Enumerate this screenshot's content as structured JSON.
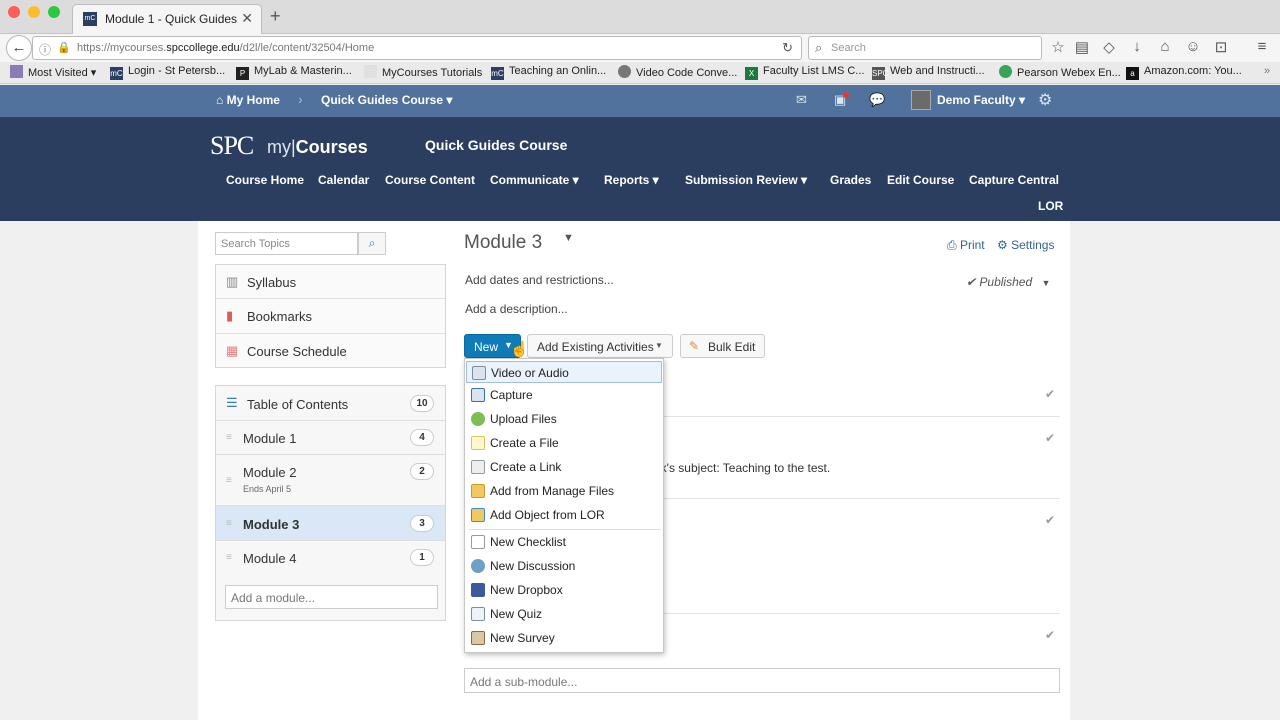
{
  "browser": {
    "tab_title": "Module 1 - Quick Guides C...",
    "tab_favicon": "mC",
    "url_prefix": "https://mycourses.",
    "url_domain": "spccollege.edu",
    "url_path": "/d2l/le/content/32504/Home",
    "search_placeholder": "Search",
    "bookmarks": [
      {
        "label": "Most Visited",
        "icon": "folder-icon"
      },
      {
        "label": "Login - St Petersb...",
        "icon": "mc-icon"
      },
      {
        "label": "MyLab & Masterin...",
        "icon": "pearson-p-icon"
      },
      {
        "label": "MyCourses Tutorials",
        "icon": "blank-page-icon"
      },
      {
        "label": "Teaching an Onlin...",
        "icon": "mc-icon"
      },
      {
        "label": "Video Code Conve...",
        "icon": "globe-icon"
      },
      {
        "label": "Faculty List LMS C...",
        "icon": "excel-icon"
      },
      {
        "label": "Web and Instructi...",
        "icon": "spc-icon"
      },
      {
        "label": "Pearson Webex En...",
        "icon": "webex-icon"
      },
      {
        "label": "Amazon.com: You...",
        "icon": "amazon-icon"
      }
    ]
  },
  "minibar": {
    "home_label": "My Home",
    "course_label": "Quick Guides Course",
    "user_label": "Demo Faculty"
  },
  "header": {
    "logo": "SPC",
    "logo_my": "my|",
    "logo_courses": "Courses",
    "course_title": "Quick Guides Course",
    "nav": [
      "Course Home",
      "Calendar",
      "Course Content",
      "Communicate ▾",
      "Reports ▾",
      "Submission Review ▾",
      "Grades",
      "Edit Course",
      "Capture Central",
      "LOR"
    ]
  },
  "sidebar": {
    "search_placeholder": "Search Topics",
    "links": [
      {
        "label": "Syllabus"
      },
      {
        "label": "Bookmarks"
      },
      {
        "label": "Course Schedule"
      }
    ],
    "toc_label": "Table of Contents",
    "toc_count": "10",
    "modules": [
      {
        "label": "Module 1",
        "count": "4",
        "sub": ""
      },
      {
        "label": "Module 2",
        "count": "2",
        "sub": "Ends April 5"
      },
      {
        "label": "Module 3",
        "count": "3",
        "sub": ""
      },
      {
        "label": "Module 4",
        "count": "1",
        "sub": ""
      }
    ],
    "add_module_placeholder": "Add a module..."
  },
  "main": {
    "module_title": "Module 3",
    "print_label": "Print",
    "settings_label": "Settings",
    "dates_label": "Add dates and restrictions...",
    "description_label": "Add a description...",
    "published_label": "Published",
    "new_label": "New",
    "existing_label": "Add Existing Activities",
    "bulk_label": "Bulk Edit",
    "partial_text": "ek's subject: Teaching to the test.",
    "add_submodule_placeholder": "Add a sub-module..."
  },
  "dropdown": {
    "items": [
      {
        "label": "Video or Audio",
        "icon": "film-icon"
      },
      {
        "label": "Capture",
        "icon": "capture-icon"
      },
      {
        "label": "Upload Files",
        "icon": "upload-cloud-icon"
      },
      {
        "label": "Create a File",
        "icon": "new-file-icon"
      },
      {
        "label": "Create a Link",
        "icon": "link-icon"
      },
      {
        "label": "Add from Manage Files",
        "icon": "folder-icon"
      },
      {
        "label": "Add Object from LOR",
        "icon": "lor-folder-icon"
      },
      {
        "label": "New Checklist",
        "icon": "checklist-icon"
      },
      {
        "label": "New Discussion",
        "icon": "discussion-icon"
      },
      {
        "label": "New Dropbox",
        "icon": "dropbox-icon"
      },
      {
        "label": "New Quiz",
        "icon": "quiz-icon"
      },
      {
        "label": "New Survey",
        "icon": "survey-icon"
      }
    ]
  },
  "colors": {
    "minibar": "#50729c",
    "header": "#2c3e5f",
    "primary_button": "#0f7cb8",
    "selected_module": "#d9e7f6"
  }
}
